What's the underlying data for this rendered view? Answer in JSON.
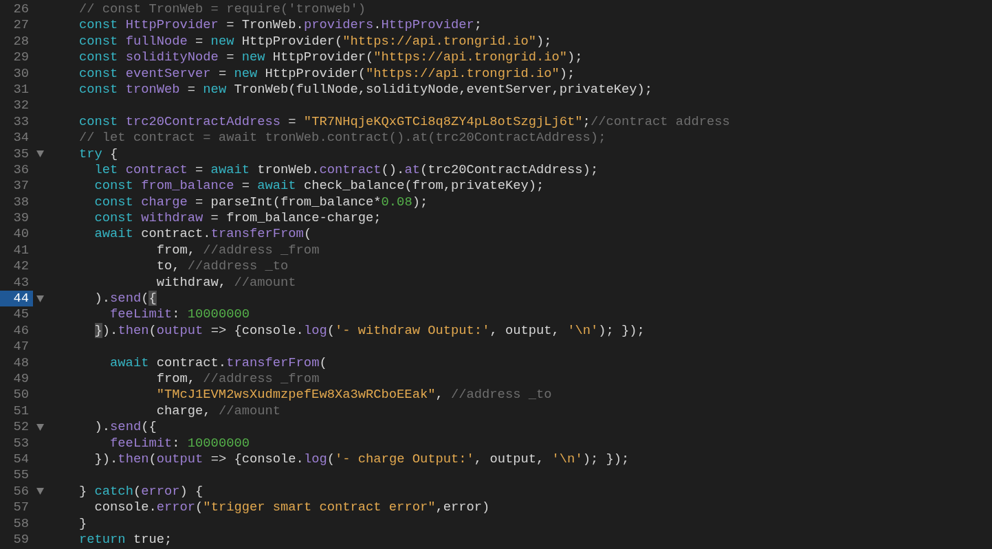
{
  "editor": {
    "lines": [
      {
        "number": "26",
        "tokens": [
          {
            "kind": "cmt",
            "text": "// const TronWeb = require('tronweb')"
          }
        ]
      },
      {
        "number": "27",
        "tokens": [
          {
            "kind": "kw",
            "text": "const"
          },
          {
            "kind": "var",
            "text": " HttpProvider"
          },
          {
            "kind": "plain",
            "text": " = TronWeb."
          },
          {
            "kind": "var",
            "text": "providers"
          },
          {
            "kind": "plain",
            "text": "."
          },
          {
            "kind": "var",
            "text": "HttpProvider"
          },
          {
            "kind": "plain",
            "text": ";"
          }
        ]
      },
      {
        "number": "28",
        "tokens": [
          {
            "kind": "kw",
            "text": "const"
          },
          {
            "kind": "var",
            "text": " fullNode"
          },
          {
            "kind": "plain",
            "text": " = "
          },
          {
            "kind": "kw",
            "text": "new"
          },
          {
            "kind": "plain",
            "text": " HttpProvider("
          },
          {
            "kind": "str",
            "text": "\"https://api.trongrid.io\""
          },
          {
            "kind": "plain",
            "text": ");"
          }
        ]
      },
      {
        "number": "29",
        "tokens": [
          {
            "kind": "kw",
            "text": "const"
          },
          {
            "kind": "var",
            "text": " solidityNode"
          },
          {
            "kind": "plain",
            "text": " = "
          },
          {
            "kind": "kw",
            "text": "new"
          },
          {
            "kind": "plain",
            "text": " HttpProvider("
          },
          {
            "kind": "str",
            "text": "\"https://api.trongrid.io\""
          },
          {
            "kind": "plain",
            "text": ");"
          }
        ]
      },
      {
        "number": "30",
        "tokens": [
          {
            "kind": "kw",
            "text": "const"
          },
          {
            "kind": "var",
            "text": " eventServer"
          },
          {
            "kind": "plain",
            "text": " = "
          },
          {
            "kind": "kw",
            "text": "new"
          },
          {
            "kind": "plain",
            "text": " HttpProvider("
          },
          {
            "kind": "str",
            "text": "\"https://api.trongrid.io\""
          },
          {
            "kind": "plain",
            "text": ");"
          }
        ]
      },
      {
        "number": "31",
        "tokens": [
          {
            "kind": "kw",
            "text": "const"
          },
          {
            "kind": "var",
            "text": " tronWeb"
          },
          {
            "kind": "plain",
            "text": " = "
          },
          {
            "kind": "kw",
            "text": "new"
          },
          {
            "kind": "plain",
            "text": " TronWeb(fullNode,solidityNode,eventServer,privateKey);"
          }
        ]
      },
      {
        "number": "32"
      },
      {
        "number": "33",
        "tokens": [
          {
            "kind": "kw",
            "text": "const"
          },
          {
            "kind": "var",
            "text": " trc20ContractAddress"
          },
          {
            "kind": "plain",
            "text": " = "
          },
          {
            "kind": "str",
            "text": "\"TR7NHqjeKQxGTCi8q8ZY4pL8otSzgjLj6t\""
          },
          {
            "kind": "plain",
            "text": ";"
          },
          {
            "kind": "cmt",
            "text": "//contract address"
          }
        ]
      },
      {
        "number": "34",
        "tokens": [
          {
            "kind": "cmt",
            "text": "// let contract = await tronWeb.contract().at(trc20ContractAddress);"
          }
        ]
      },
      {
        "number": "35",
        "foldable": true,
        "tokens": [
          {
            "kind": "kw",
            "text": "try"
          },
          {
            "kind": "plain",
            "text": " {"
          }
        ]
      },
      {
        "number": "36",
        "tokens": [
          {
            "kind": "kw",
            "text": "  let"
          },
          {
            "kind": "var",
            "text": " contract"
          },
          {
            "kind": "plain",
            "text": " = "
          },
          {
            "kind": "kw",
            "text": "await"
          },
          {
            "kind": "plain",
            "text": " tronWeb."
          },
          {
            "kind": "var",
            "text": "contract"
          },
          {
            "kind": "plain",
            "text": "()."
          },
          {
            "kind": "var",
            "text": "at"
          },
          {
            "kind": "plain",
            "text": "(trc20ContractAddress);"
          }
        ]
      },
      {
        "number": "37",
        "tokens": [
          {
            "kind": "kw",
            "text": "  const"
          },
          {
            "kind": "var",
            "text": " from_balance"
          },
          {
            "kind": "plain",
            "text": " = "
          },
          {
            "kind": "kw",
            "text": "await"
          },
          {
            "kind": "plain",
            "text": " check_balance(from,privateKey);"
          }
        ]
      },
      {
        "number": "38",
        "tokens": [
          {
            "kind": "kw",
            "text": "  const"
          },
          {
            "kind": "var",
            "text": " charge"
          },
          {
            "kind": "plain",
            "text": " = parseInt(from_balance*"
          },
          {
            "kind": "num",
            "text": "0.08"
          },
          {
            "kind": "plain",
            "text": ");"
          }
        ]
      },
      {
        "number": "39",
        "tokens": [
          {
            "kind": "kw",
            "text": "  const"
          },
          {
            "kind": "var",
            "text": " withdraw"
          },
          {
            "kind": "plain",
            "text": " = from_balance-charge;"
          }
        ]
      },
      {
        "number": "40",
        "tokens": [
          {
            "kind": "kw",
            "text": "  await"
          },
          {
            "kind": "plain",
            "text": " contract."
          },
          {
            "kind": "var",
            "text": "transferFrom"
          },
          {
            "kind": "plain",
            "text": "("
          }
        ]
      },
      {
        "number": "41",
        "tokens": [
          {
            "kind": "plain",
            "text": "          from, "
          },
          {
            "kind": "cmt",
            "text": "//address _from"
          }
        ]
      },
      {
        "number": "42",
        "tokens": [
          {
            "kind": "plain",
            "text": "          to, "
          },
          {
            "kind": "cmt",
            "text": "//address _to"
          }
        ]
      },
      {
        "number": "43",
        "tokens": [
          {
            "kind": "plain",
            "text": "          withdraw, "
          },
          {
            "kind": "cmt",
            "text": "//amount"
          }
        ]
      },
      {
        "number": "44",
        "foldable": true,
        "current": true,
        "tokens": [
          {
            "kind": "plain",
            "text": "  )."
          },
          {
            "kind": "var",
            "text": "send"
          },
          {
            "kind": "plain",
            "text": "("
          },
          {
            "kind": "plain",
            "text": "{",
            "bracket_match": true
          }
        ]
      },
      {
        "number": "45",
        "tokens": [
          {
            "kind": "var",
            "text": "    feeLimit"
          },
          {
            "kind": "plain",
            "text": ": "
          },
          {
            "kind": "num",
            "text": "10000000"
          }
        ]
      },
      {
        "number": "46",
        "tokens": [
          {
            "kind": "plain",
            "text": "  }",
            "bracket_match": true
          },
          {
            "kind": "plain",
            "text": ")."
          },
          {
            "kind": "var",
            "text": "then"
          },
          {
            "kind": "plain",
            "text": "("
          },
          {
            "kind": "var",
            "text": "output"
          },
          {
            "kind": "plain",
            "text": " => {console."
          },
          {
            "kind": "var",
            "text": "log"
          },
          {
            "kind": "plain",
            "text": "("
          },
          {
            "kind": "str",
            "text": "'- withdraw Output:'"
          },
          {
            "kind": "plain",
            "text": ", output, "
          },
          {
            "kind": "str",
            "text": "'\\n'"
          },
          {
            "kind": "plain",
            "text": "); });"
          }
        ]
      },
      {
        "number": "47"
      },
      {
        "number": "48",
        "tokens": [
          {
            "kind": "kw",
            "text": "    await"
          },
          {
            "kind": "plain",
            "text": " contract."
          },
          {
            "kind": "var",
            "text": "transferFrom"
          },
          {
            "kind": "plain",
            "text": "("
          }
        ]
      },
      {
        "number": "49",
        "tokens": [
          {
            "kind": "plain",
            "text": "          from, "
          },
          {
            "kind": "cmt",
            "text": "//address _from"
          }
        ]
      },
      {
        "number": "50",
        "tokens": [
          {
            "kind": "str",
            "text": "          \"TMcJ1EVM2wsXudmzpefEw8Xa3wRCboEEak\""
          },
          {
            "kind": "plain",
            "text": ", "
          },
          {
            "kind": "cmt",
            "text": "//address _to"
          }
        ]
      },
      {
        "number": "51",
        "tokens": [
          {
            "kind": "plain",
            "text": "          charge, "
          },
          {
            "kind": "cmt",
            "text": "//amount"
          }
        ]
      },
      {
        "number": "52",
        "foldable": true,
        "tokens": [
          {
            "kind": "plain",
            "text": "  )."
          },
          {
            "kind": "var",
            "text": "send"
          },
          {
            "kind": "plain",
            "text": "({"
          }
        ]
      },
      {
        "number": "53",
        "tokens": [
          {
            "kind": "var",
            "text": "    feeLimit"
          },
          {
            "kind": "plain",
            "text": ": "
          },
          {
            "kind": "num",
            "text": "10000000"
          }
        ]
      },
      {
        "number": "54",
        "tokens": [
          {
            "kind": "plain",
            "text": "  })."
          },
          {
            "kind": "var",
            "text": "then"
          },
          {
            "kind": "plain",
            "text": "("
          },
          {
            "kind": "var",
            "text": "output"
          },
          {
            "kind": "plain",
            "text": " => {console."
          },
          {
            "kind": "var",
            "text": "log"
          },
          {
            "kind": "plain",
            "text": "("
          },
          {
            "kind": "str",
            "text": "'- charge Output:'"
          },
          {
            "kind": "plain",
            "text": ", output, "
          },
          {
            "kind": "str",
            "text": "'\\n'"
          },
          {
            "kind": "plain",
            "text": "); });"
          }
        ]
      },
      {
        "number": "55"
      },
      {
        "number": "56",
        "foldable": true,
        "tokens": [
          {
            "kind": "plain",
            "text": "} "
          },
          {
            "kind": "kw",
            "text": "catch"
          },
          {
            "kind": "plain",
            "text": "("
          },
          {
            "kind": "var",
            "text": "error"
          },
          {
            "kind": "plain",
            "text": ") {"
          }
        ]
      },
      {
        "number": "57",
        "tokens": [
          {
            "kind": "plain",
            "text": "  console."
          },
          {
            "kind": "var",
            "text": "error"
          },
          {
            "kind": "plain",
            "text": "("
          },
          {
            "kind": "str",
            "text": "\"trigger smart contract error\""
          },
          {
            "kind": "plain",
            "text": ",error)"
          }
        ]
      },
      {
        "number": "58",
        "tokens": [
          {
            "kind": "plain",
            "text": "}"
          }
        ]
      },
      {
        "number": "59",
        "tokens": [
          {
            "kind": "kw",
            "text": "return"
          },
          {
            "kind": "plain",
            "text": " true;"
          }
        ]
      }
    ]
  }
}
